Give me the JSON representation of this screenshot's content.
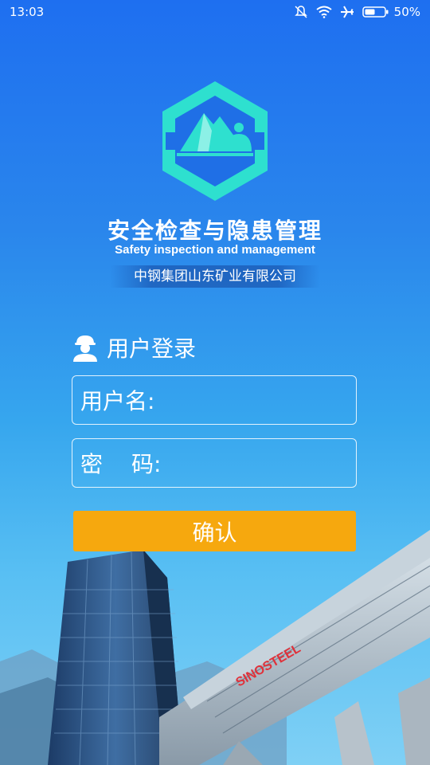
{
  "status": {
    "time": "13:03",
    "battery_percent": "50%",
    "icons": [
      "notification-off-icon",
      "wifi-icon",
      "airplane-icon",
      "battery-icon"
    ]
  },
  "app": {
    "title_cn": "安全检查与隐患管理",
    "title_en": "Safety inspection and management",
    "company": "中钢集团山东矿业有限公司"
  },
  "login": {
    "heading": "用户登录",
    "username_label": "用户名:",
    "password_label_1": "密",
    "password_label_2": "码:",
    "username_value": "",
    "password_value": "",
    "confirm_label": "确认"
  },
  "background": {
    "building_sign": "SINOSTEEL"
  },
  "colors": {
    "sky_top": "#1e6ff0",
    "logo_teal": "#2ee0cf",
    "confirm_orange": "#f6a80e"
  }
}
